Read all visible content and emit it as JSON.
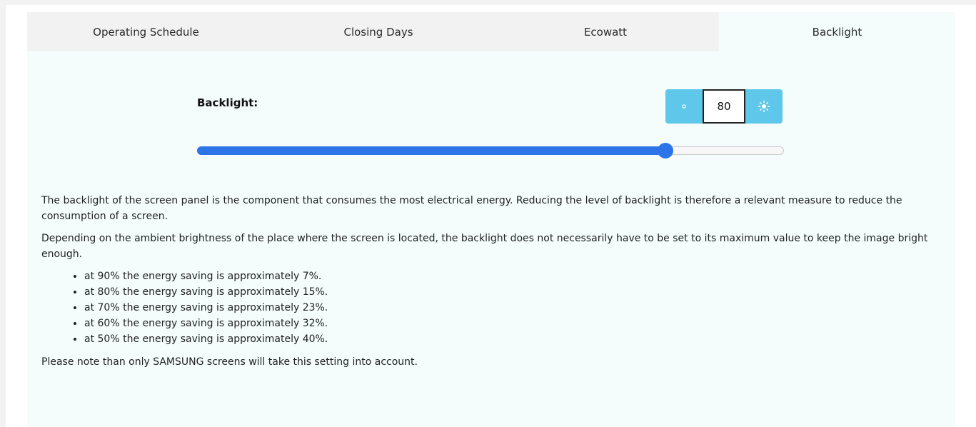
{
  "tabs": [
    {
      "label": "Operating Schedule"
    },
    {
      "label": "Closing Days"
    },
    {
      "label": "Ecowatt"
    },
    {
      "label": "Backlight"
    }
  ],
  "active_tab": "Backlight",
  "backlight": {
    "label": "Backlight:",
    "value": "80",
    "slider_value": 80,
    "slider_min": 0,
    "slider_max": 100,
    "decrease_icon": "sun-small-icon",
    "increase_icon": "sun-large-icon"
  },
  "description": {
    "paragraph1": "The backlight of the screen panel is the component that consumes the most electrical energy. Reducing the level of backlight is therefore a relevant measure to reduce the consumption of a screen.",
    "paragraph2": "Depending on the ambient brightness of the place where the screen is located, the backlight does not necessarily have to be set to its maximum value to keep the image bright enough.",
    "savings": [
      "at 90% the energy saving is approximately 7%.",
      "at 80% the energy saving is approximately 15%.",
      "at 70% the energy saving is approximately 23%.",
      "at 60% the energy saving is approximately 32%.",
      "at 50% the energy saving is approximately 40%."
    ],
    "note": "Please note than only SAMSUNG screens will take this setting into account."
  },
  "colors": {
    "accent_blue": "#2c74e8",
    "button_cyan": "#5ec7ea",
    "panel_bg": "#f4fcfc"
  }
}
